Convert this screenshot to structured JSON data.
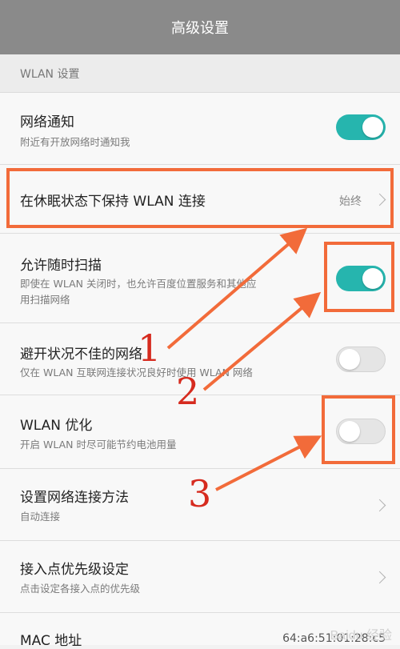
{
  "header": {
    "title": "高级设置"
  },
  "section": {
    "title": "WLAN 设置"
  },
  "rows": [
    {
      "title": "网络通知",
      "subtitle": "附近有开放网络时通知我",
      "toggle": "on"
    },
    {
      "title": "在休眠状态下保持 WLAN 连接",
      "value": "始终"
    },
    {
      "title": "允许随时扫描",
      "subtitle_line1": "即使在 WLAN 关闭时，也允许百度位置服务和其他应",
      "subtitle_line2": "用扫描网络",
      "toggle": "on"
    },
    {
      "title": "避开状况不佳的网络",
      "subtitle": "仅在 WLAN 互联网连接状况良好时使用 WLAN 网络",
      "toggle": "off"
    },
    {
      "title": "WLAN 优化",
      "subtitle": "开启 WLAN 时尽可能节约电池用量",
      "toggle": "off"
    },
    {
      "title": "设置网络连接方法",
      "subtitle": "自动连接"
    },
    {
      "title": "接入点优先级设定",
      "subtitle": "点击设定各接入点的优先级"
    },
    {
      "title": "MAC 地址",
      "value": "64:a6:51:01:28:c5"
    }
  ],
  "annotations": {
    "labels": [
      "1",
      "2",
      "3"
    ],
    "color_box": "#f26b3a",
    "color_number": "#d62b1f"
  },
  "watermark": "Baidu 经验",
  "colors": {
    "toggle_on": "#26b5ae",
    "header_bg": "#8a8a8a"
  }
}
